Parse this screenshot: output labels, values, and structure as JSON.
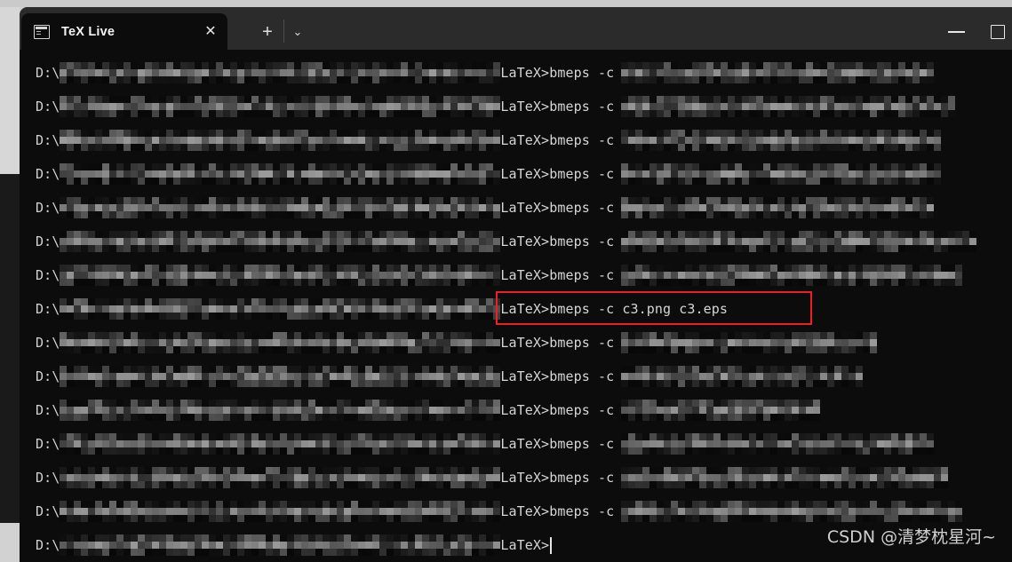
{
  "window": {
    "app": "Windows Terminal",
    "tab": {
      "title": "TeX Live",
      "icon": "console-icon",
      "close_label": "✕"
    },
    "new_tab_label": "+",
    "dropdown_label": "⌄",
    "controls": {
      "minimize_label": "─",
      "maximize_label": "□"
    }
  },
  "console": {
    "prompt_drive": "D:\\",
    "prompt_tail": "LaTeX>",
    "command_prefix": "bmeps -c",
    "lines": [
      {
        "prefix": "D:\\",
        "path_blocks": 62,
        "tail": "LaTeX>bmeps -c",
        "arg_blocks": 44,
        "redacted": true
      },
      {
        "prefix": "D:\\",
        "path_blocks": 62,
        "tail": "LaTeX>bmeps -c",
        "arg_blocks": 47,
        "redacted": true
      },
      {
        "prefix": "D:\\",
        "path_blocks": 62,
        "tail": "LaTeX>bmeps -c",
        "arg_blocks": 45,
        "redacted": true
      },
      {
        "prefix": "D:\\",
        "path_blocks": 62,
        "tail": "LaTeX>bmeps -c",
        "arg_blocks": 45,
        "redacted": true
      },
      {
        "prefix": "D:\\",
        "path_blocks": 62,
        "tail": "LaTeX>bmeps -c",
        "arg_blocks": 44,
        "redacted": true
      },
      {
        "prefix": "D:\\",
        "path_blocks": 62,
        "tail": "LaTeX>bmeps -c",
        "arg_blocks": 50,
        "redacted": true
      },
      {
        "prefix": "D:\\",
        "path_blocks": 62,
        "tail": "LaTeX>bmeps -c",
        "arg_blocks": 48,
        "redacted": true
      },
      {
        "prefix": "D:\\",
        "path_blocks": 62,
        "tail": "LaTeX>bmeps -c c3.png c3.eps",
        "arg_blocks": 0,
        "redacted": false,
        "highlighted": true
      },
      {
        "prefix": "D:\\",
        "path_blocks": 62,
        "tail": "LaTeX>bmeps -c",
        "arg_blocks": 36,
        "redacted": true
      },
      {
        "prefix": "D:\\",
        "path_blocks": 62,
        "tail": "LaTeX>bmeps -c",
        "arg_blocks": 34,
        "redacted": true
      },
      {
        "prefix": "D:\\",
        "path_blocks": 62,
        "tail": "LaTeX>bmeps -c",
        "arg_blocks": 28,
        "redacted": true
      },
      {
        "prefix": "D:\\",
        "path_blocks": 62,
        "tail": "LaTeX>bmeps -c",
        "arg_blocks": 44,
        "redacted": true
      },
      {
        "prefix": "D:\\",
        "path_blocks": 62,
        "tail": "LaTeX>bmeps -c",
        "arg_blocks": 46,
        "redacted": true
      },
      {
        "prefix": "D:\\",
        "path_blocks": 62,
        "tail": "LaTeX>bmeps -c",
        "arg_blocks": 48,
        "redacted": true
      },
      {
        "prefix": "D:\\",
        "path_blocks": 62,
        "tail": "LaTeX>",
        "arg_blocks": 0,
        "redacted": true,
        "cursor": true
      }
    ],
    "highlighted_command": "LaTeX>bmeps -c c3.png c3.eps"
  },
  "watermark": {
    "text": "CSDN @清梦枕星河~"
  },
  "colors": {
    "terminal_bg": "#0c0c0c",
    "titlebar_bg": "#2b2b2b",
    "text": "#cfcfcf",
    "highlight_border": "#ec2024"
  }
}
